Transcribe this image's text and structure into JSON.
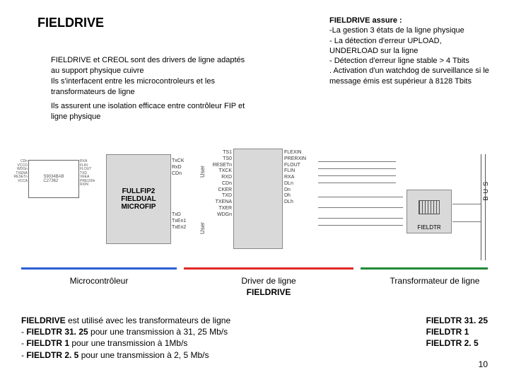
{
  "title": "FIELDRIVE",
  "intro": {
    "p1": "FIELDRIVE et CREOL sont des drivers de ligne adaptés au support physique cuivre",
    "p2": "Ils s'interfacent entre les microcontroleurs et les transformateurs de ligne",
    "p3": "Ils assurent une isolation efficace entre contrôleur FIP et ligne physique"
  },
  "assure": {
    "head": "FIELDRIVE assure :",
    "l1": "-La gestion 3 états de la ligne physique",
    "l2": "- La détection d'erreur UPLOAD, UNDERLOAD sur la ligne",
    "l3": "- Détection d'erreur ligne stable > 4 Tbits",
    "l4": ". Activation d'un watchdog de surveillance si le message émis est supérieur à 8128 Tbits"
  },
  "diagram": {
    "mcu_pins_left": "CDn\nVCCO\nWDGn\nTXENA\nRESETn\nVCCA",
    "mcu_pins_right": "RXA\nFLIN\nFLOUT\nTXD\nVEEA\nPRE100n\nRXIN",
    "mcu_core": "S9034BAB\nC27362",
    "fullfip": "FULLFIP2\nFIELDUAL\nMICROFIP",
    "fullfip_right_top": "TxCK\nRxD\nCDn",
    "fullfip_right_bot": "TxD\nTxEn1\nTxEn2",
    "user": "User",
    "fieldrive_left": "TS1\nTS0\nRESETn\nTXCK\nRXD\nCDn\nCKER\nTXD\nTXENA\nTXER\nWDGn",
    "fieldrive_right": "FLEXIN\nPRERXIN\nFLOUT\nFLIN\nRXA\nDLn\nDn\nDh\nDLh",
    "fieldtr_label": "FIELDTR",
    "bus": "BUS"
  },
  "captions": {
    "mcu": "Microcontrôleur",
    "drv1": "Driver de ligne",
    "drv2": "FIELDRIVE",
    "tr": "Transformateur de ligne"
  },
  "footer": {
    "lead": "FIELDRIVE",
    "lead2": " est utilisé avec les transformateurs de ligne",
    "l1a": "- ",
    "l1b": "FIELDTR 31. 25",
    "l1c": " pour une transmission à 31, 25 Mb/s",
    "l2a": "- ",
    "l2b": "FIELDTR 1",
    "l2c": " pour une transmission à 1Mb/s",
    "l3a": "- ",
    "l3b": "FIELDTR 2. 5",
    "l3c": " pour une transmission à 2, 5 Mb/s"
  },
  "trlist": {
    "a": "FIELDTR 31. 25",
    "b": "FIELDTR 1",
    "c": "FIELDTR 2. 5"
  },
  "page": "10"
}
